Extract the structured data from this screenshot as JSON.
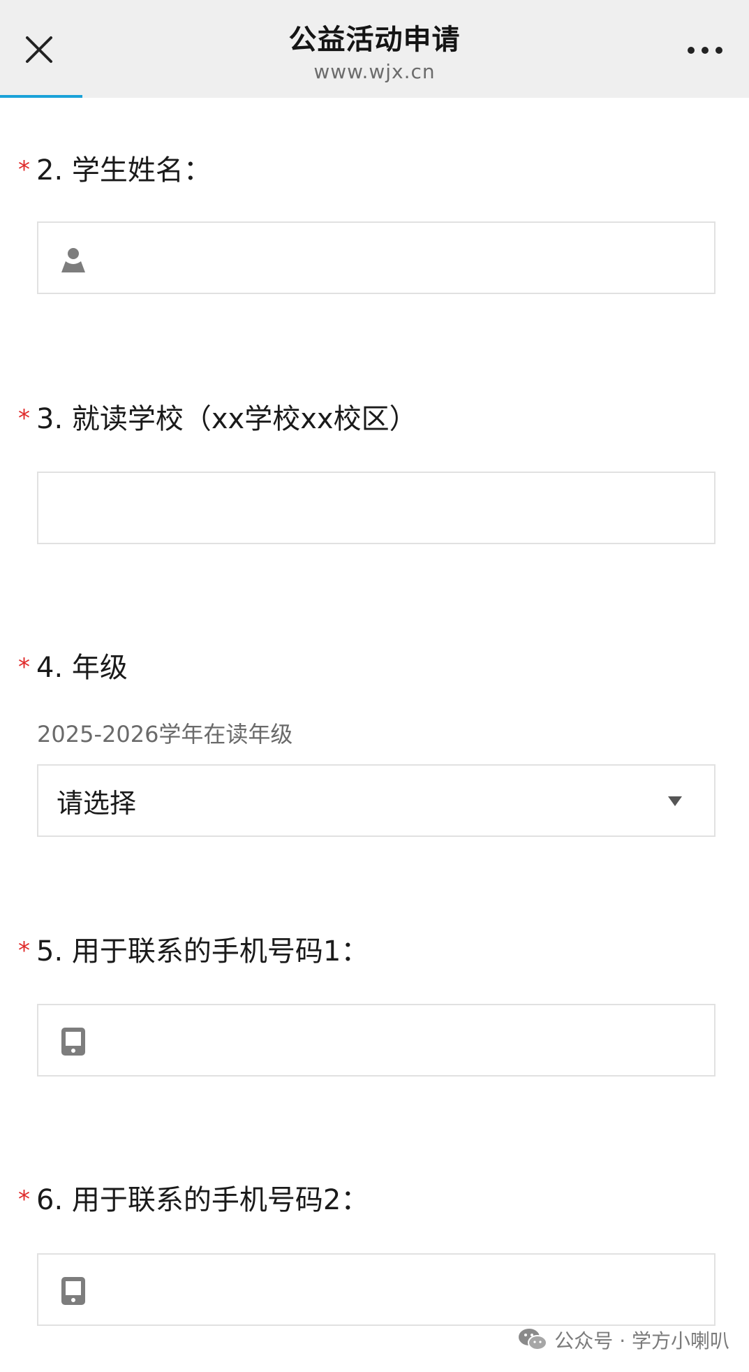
{
  "app": {
    "title": "公益活动申请",
    "url": "www.wjx.cn",
    "close_icon": "close-icon",
    "more_icon": "more-dots-icon",
    "progress_fraction": 0.11,
    "accent_color": "#1aa2d8",
    "required_color": "#e02b2b"
  },
  "form": {
    "questions": [
      {
        "required_mark": "*",
        "label": "2. 学生姓名：",
        "field_icon": "person-icon",
        "value": ""
      },
      {
        "required_mark": "*",
        "label": "3. 就读学校（xx学校xx校区）",
        "value": ""
      },
      {
        "required_mark": "*",
        "label": "4. 年级",
        "description": "2025-2026学年在读年级",
        "select_value": "请选择",
        "select_icon": "dropdown-arrow-icon"
      },
      {
        "required_mark": "*",
        "label": "5. 用于联系的手机号码1：",
        "field_icon": "phone-icon",
        "value": ""
      },
      {
        "required_mark": "*",
        "label": "6. 用于联系的手机号码2：",
        "field_icon": "phone-icon",
        "value": ""
      }
    ]
  },
  "watermark": {
    "icon": "wechat-icon",
    "text": "公众号 · 学方小喇叭"
  }
}
